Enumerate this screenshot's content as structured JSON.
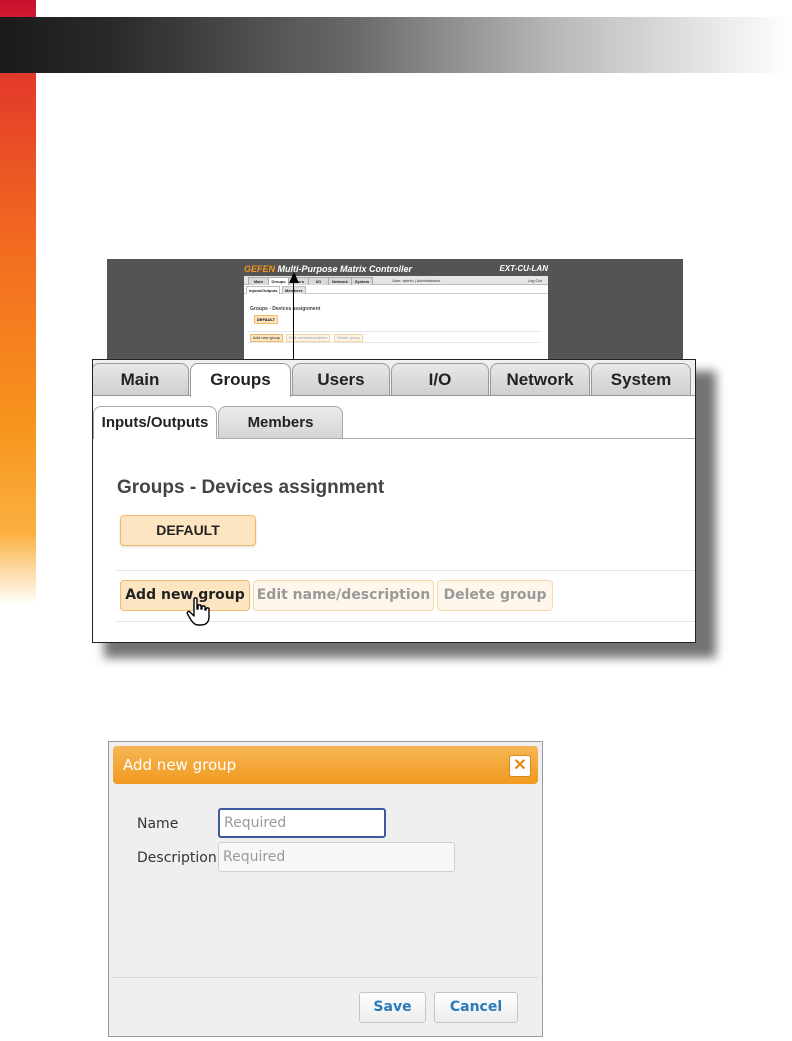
{
  "overview": {
    "brand": "GEFEN",
    "title": "Multi-Purpose Matrix Controller",
    "model": "EXT-CU-LAN",
    "tabs": [
      "Main",
      "Groups",
      "Users",
      "I/O",
      "Network",
      "System"
    ],
    "user_info": "User: admin  |  Administrator",
    "logout": "Log Out",
    "subtabs": [
      "Inputs/Outputs",
      "Members"
    ],
    "heading": "Groups - Devices assignment",
    "default_button": "DEFAULT",
    "actions": [
      "Add new group",
      "Edit name/description",
      "Delete group"
    ]
  },
  "zoom": {
    "tabs": [
      "Main",
      "Groups",
      "Users",
      "I/O",
      "Network",
      "System"
    ],
    "active_tab": "Groups",
    "subtabs": [
      "Inputs/Outputs",
      "Members"
    ],
    "active_subtab": "Inputs/Outputs",
    "heading": "Groups - Devices assignment",
    "default_button": "DEFAULT",
    "actions": {
      "add": "Add new group",
      "edit": "Edit name/description",
      "delete": "Delete group"
    }
  },
  "dialog": {
    "title": "Add new group",
    "close_icon": "close-icon",
    "name_label": "Name",
    "name_placeholder": "Required",
    "description_label": "Description",
    "description_placeholder": "Required",
    "save_label": "Save",
    "cancel_label": "Cancel"
  },
  "colors": {
    "accent_orange": "#f09a1f",
    "button_fill": "#fde5c2",
    "link_blue": "#2a7ab8",
    "focus_blue": "#3c5a9a"
  }
}
